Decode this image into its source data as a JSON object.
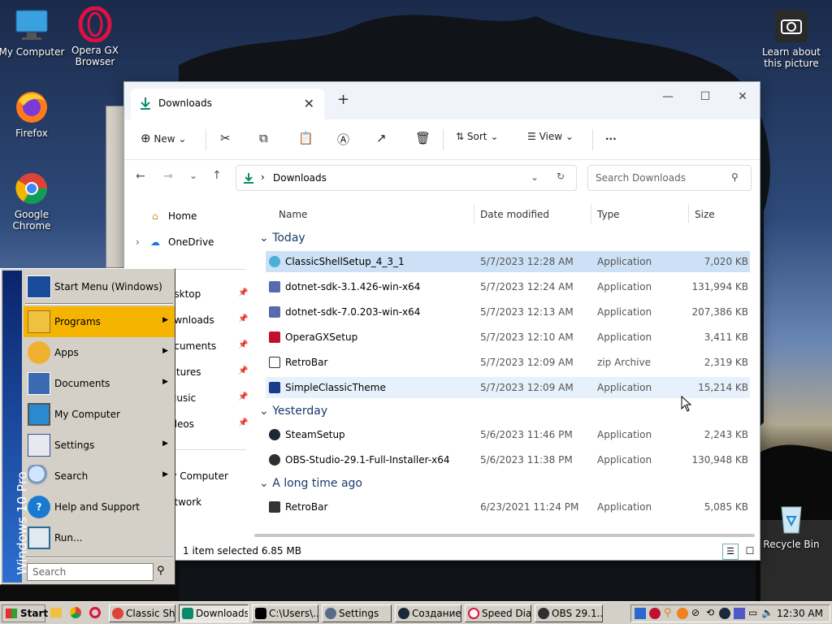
{
  "desktop": {
    "icons": [
      {
        "label": "My Computer"
      },
      {
        "label": "Opera GX Browser"
      },
      {
        "label": "Firefox"
      },
      {
        "label": "Google Chrome"
      },
      {
        "label": "Learn about this picture"
      },
      {
        "label": "Recycle Bin"
      }
    ]
  },
  "explorer": {
    "tab_title": "Downloads",
    "toolbar": {
      "new_label": "New",
      "sort_label": "Sort",
      "view_label": "View",
      "more_label": "..."
    },
    "address": "Downloads",
    "search_placeholder": "Search Downloads",
    "nav": {
      "home": "Home",
      "onedrive": "OneDrive",
      "desktop": "esktop",
      "downloads": "ownloads",
      "documents": "ocuments",
      "pictures": "ictures",
      "music": "Music",
      "videos": "ideos",
      "this_pc": "ly Computer",
      "network": "etwork"
    },
    "columns": {
      "name": "Name",
      "date": "Date modified",
      "type": "Type",
      "size": "Size"
    },
    "groups": [
      {
        "label": "Today"
      },
      {
        "label": "Yesterday"
      },
      {
        "label": "A long time ago"
      }
    ],
    "files": [
      {
        "name": "ClassicShellSetup_4_3_1",
        "date": "5/7/2023 12:28 AM",
        "type": "Application",
        "size": "7,020 KB"
      },
      {
        "name": "dotnet-sdk-3.1.426-win-x64",
        "date": "5/7/2023 12:24 AM",
        "type": "Application",
        "size": "131,994 KB"
      },
      {
        "name": "dotnet-sdk-7.0.203-win-x64",
        "date": "5/7/2023 12:13 AM",
        "type": "Application",
        "size": "207,386 KB"
      },
      {
        "name": "OperaGXSetup",
        "date": "5/7/2023 12:10 AM",
        "type": "Application",
        "size": "3,411 KB"
      },
      {
        "name": "RetroBar",
        "date": "5/7/2023 12:09 AM",
        "type": "zip Archive",
        "size": "2,319 KB"
      },
      {
        "name": "SimpleClassicTheme",
        "date": "5/7/2023 12:09 AM",
        "type": "Application",
        "size": "15,214 KB"
      },
      {
        "name": "SteamSetup",
        "date": "5/6/2023 11:46 PM",
        "type": "Application",
        "size": "2,243 KB"
      },
      {
        "name": "OBS-Studio-29.1-Full-Installer-x64",
        "date": "5/6/2023 11:38 PM",
        "type": "Application",
        "size": "130,948 KB"
      },
      {
        "name": "RetroBar",
        "date": "6/23/2021 11:24 PM",
        "type": "Application",
        "size": "5,085 KB"
      }
    ],
    "status": "1 item selected  6.85 MB"
  },
  "start_menu": {
    "sidebar_text": "Windows 10 Pro",
    "header": "Start Menu (Windows)",
    "items": [
      {
        "label": "Programs"
      },
      {
        "label": "Apps"
      },
      {
        "label": "Documents"
      },
      {
        "label": "My Computer"
      },
      {
        "label": "Settings"
      },
      {
        "label": "Search"
      },
      {
        "label": "Help and Support"
      },
      {
        "label": "Run..."
      }
    ],
    "search_placeholder": "Search"
  },
  "taskbar": {
    "start_label": "Start",
    "tasks": [
      {
        "label": "Classic Sh..."
      },
      {
        "label": "Downloads"
      },
      {
        "label": "C:\\Users\\..."
      },
      {
        "label": "Settings"
      },
      {
        "label": "Создание..."
      },
      {
        "label": "Speed Dia..."
      },
      {
        "label": "OBS 29.1..."
      }
    ],
    "clock": "12:30 AM"
  }
}
